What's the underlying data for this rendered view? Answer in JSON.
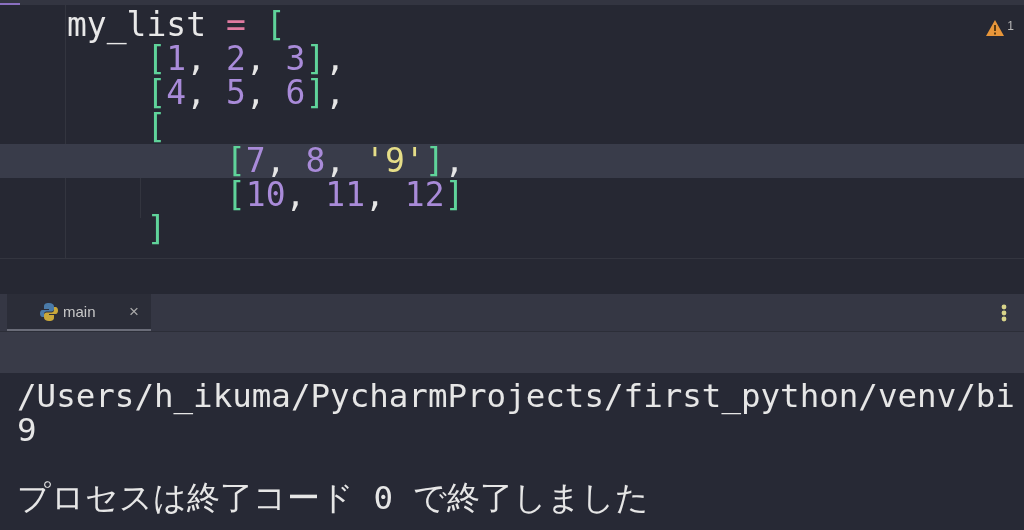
{
  "editor": {
    "warnings": {
      "count": "1"
    },
    "lines": [
      {
        "current": false,
        "tokens": [
          {
            "kind": "name",
            "text": "my_list"
          },
          {
            "kind": "op",
            "text": " = "
          },
          {
            "kind": "bracket",
            "text": "["
          }
        ]
      },
      {
        "current": false,
        "tokens": [
          {
            "kind": "bracket",
            "text": "    ["
          },
          {
            "kind": "number",
            "text": "1"
          },
          {
            "kind": "plain",
            "text": ", "
          },
          {
            "kind": "number",
            "text": "2"
          },
          {
            "kind": "plain",
            "text": ", "
          },
          {
            "kind": "number",
            "text": "3"
          },
          {
            "kind": "bracket",
            "text": "]"
          },
          {
            "kind": "plain",
            "text": ","
          }
        ]
      },
      {
        "current": false,
        "tokens": [
          {
            "kind": "bracket",
            "text": "    ["
          },
          {
            "kind": "number",
            "text": "4"
          },
          {
            "kind": "plain",
            "text": ", "
          },
          {
            "kind": "number",
            "text": "5"
          },
          {
            "kind": "plain",
            "text": ", "
          },
          {
            "kind": "number",
            "text": "6"
          },
          {
            "kind": "bracket",
            "text": "]"
          },
          {
            "kind": "plain",
            "text": ","
          }
        ]
      },
      {
        "current": false,
        "tokens": [
          {
            "kind": "bracket",
            "text": "    ["
          }
        ]
      },
      {
        "current": true,
        "tokens": [
          {
            "kind": "bracket",
            "text": "        ["
          },
          {
            "kind": "number",
            "text": "7"
          },
          {
            "kind": "plain",
            "text": ", "
          },
          {
            "kind": "number",
            "text": "8"
          },
          {
            "kind": "plain",
            "text": ", "
          },
          {
            "kind": "string",
            "text": "'9'"
          },
          {
            "kind": "bracket",
            "text": "]"
          },
          {
            "kind": "plain",
            "text": ","
          }
        ]
      },
      {
        "current": false,
        "tokens": [
          {
            "kind": "bracket",
            "text": "        ["
          },
          {
            "kind": "number",
            "text": "10"
          },
          {
            "kind": "plain",
            "text": ", "
          },
          {
            "kind": "number",
            "text": "11"
          },
          {
            "kind": "plain",
            "text": ", "
          },
          {
            "kind": "number",
            "text": "12"
          },
          {
            "kind": "bracket",
            "text": "]"
          }
        ]
      },
      {
        "current": false,
        "tokens": [
          {
            "kind": "bracket",
            "text": "    ]"
          }
        ]
      }
    ]
  },
  "run_panel": {
    "tabs": [
      {
        "label": "main",
        "close": "×",
        "selected": true
      }
    ]
  },
  "console": {
    "lines": [
      {
        "kind": "output",
        "text": "/Users/h_ikuma/PycharmProjects/first_python/venv/bi"
      },
      {
        "kind": "output",
        "text": "9"
      },
      {
        "kind": "status",
        "text": "プロセスは終了コード 0 で終了しました"
      }
    ]
  }
}
